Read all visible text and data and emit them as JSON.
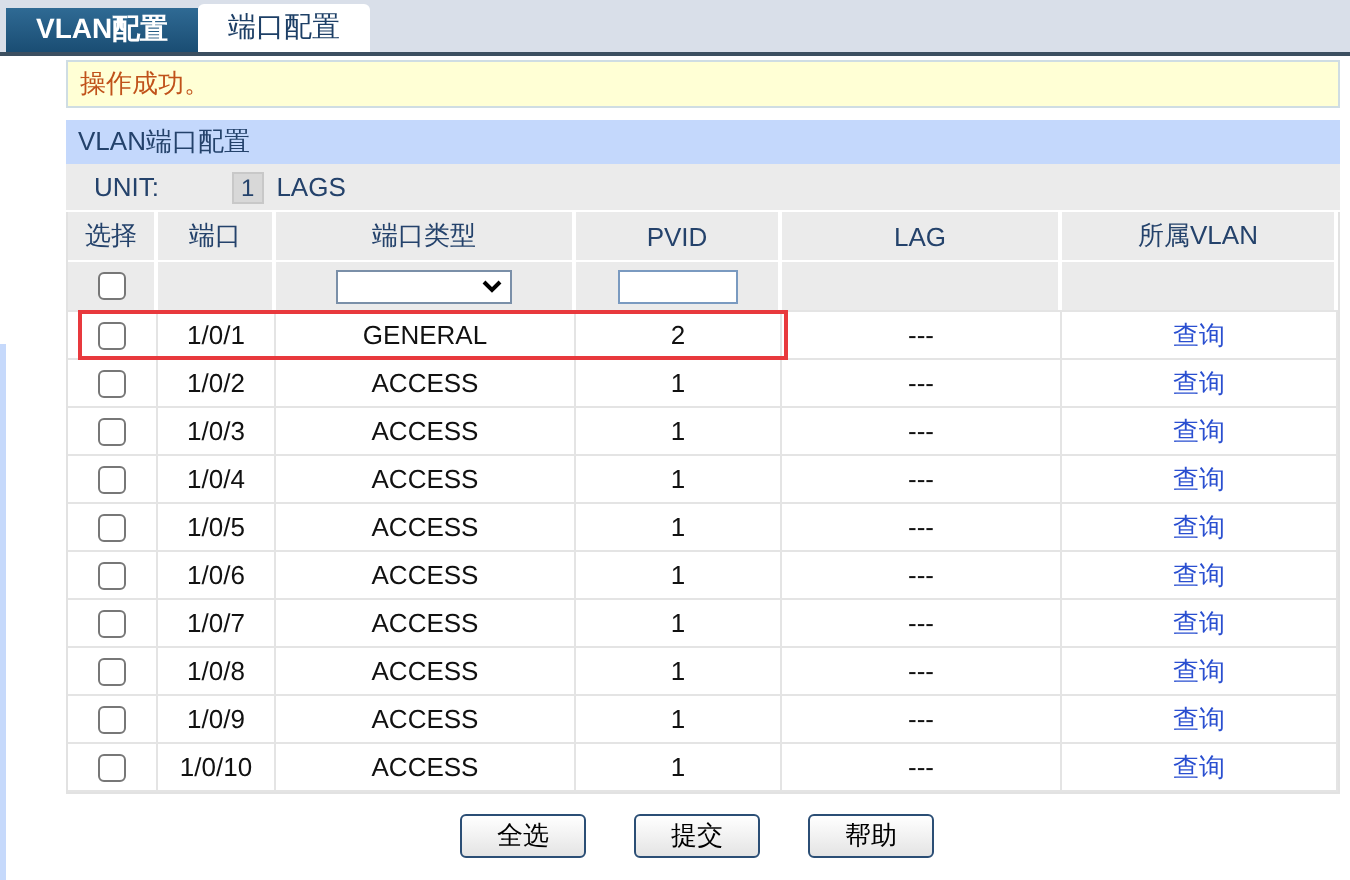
{
  "tabs": [
    {
      "label": "VLAN配置",
      "selected": false
    },
    {
      "label": "端口配置",
      "selected": true
    }
  ],
  "message": "操作成功。",
  "section_title": "VLAN端口配置",
  "unit": {
    "label": "UNIT:",
    "value": "1",
    "lags": "LAGS"
  },
  "table": {
    "columns": [
      "选择",
      "端口",
      "端口类型",
      "PVID",
      "LAG",
      "所属VLAN"
    ],
    "filter": {
      "checked": false
    },
    "rows": [
      {
        "checked": false,
        "port": "1/0/1",
        "type": "GENERAL",
        "pvid": "2",
        "lag": "---",
        "vlan": "查询",
        "highlighted": true
      },
      {
        "checked": false,
        "port": "1/0/2",
        "type": "ACCESS",
        "pvid": "1",
        "lag": "---",
        "vlan": "查询",
        "highlighted": false
      },
      {
        "checked": false,
        "port": "1/0/3",
        "type": "ACCESS",
        "pvid": "1",
        "lag": "---",
        "vlan": "查询",
        "highlighted": false
      },
      {
        "checked": false,
        "port": "1/0/4",
        "type": "ACCESS",
        "pvid": "1",
        "lag": "---",
        "vlan": "查询",
        "highlighted": false
      },
      {
        "checked": false,
        "port": "1/0/5",
        "type": "ACCESS",
        "pvid": "1",
        "lag": "---",
        "vlan": "查询",
        "highlighted": false
      },
      {
        "checked": false,
        "port": "1/0/6",
        "type": "ACCESS",
        "pvid": "1",
        "lag": "---",
        "vlan": "查询",
        "highlighted": false
      },
      {
        "checked": false,
        "port": "1/0/7",
        "type": "ACCESS",
        "pvid": "1",
        "lag": "---",
        "vlan": "查询",
        "highlighted": false
      },
      {
        "checked": false,
        "port": "1/0/8",
        "type": "ACCESS",
        "pvid": "1",
        "lag": "---",
        "vlan": "查询",
        "highlighted": false
      },
      {
        "checked": false,
        "port": "1/0/9",
        "type": "ACCESS",
        "pvid": "1",
        "lag": "---",
        "vlan": "查询",
        "highlighted": false
      },
      {
        "checked": false,
        "port": "1/0/10",
        "type": "ACCESS",
        "pvid": "1",
        "lag": "---",
        "vlan": "查询",
        "highlighted": false
      }
    ]
  },
  "buttons": [
    "全选",
    "提交",
    "帮助"
  ]
}
